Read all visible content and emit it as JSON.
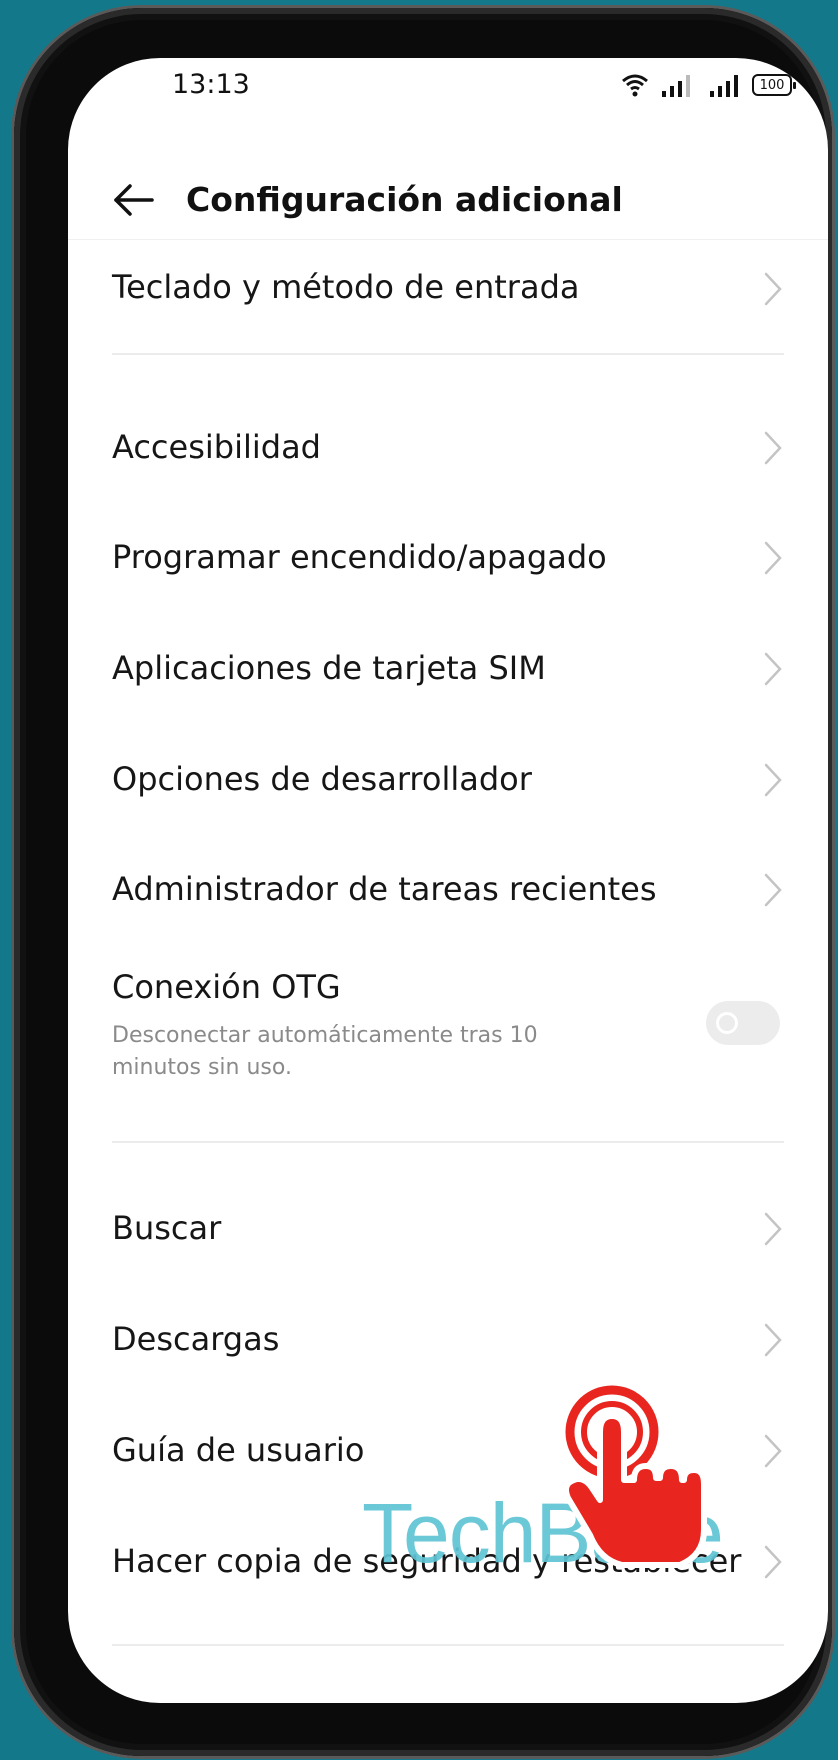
{
  "status_bar": {
    "time": "13:13",
    "battery": "100",
    "icons": [
      "wifi-icon",
      "signal-icon",
      "signal-icon",
      "battery-icon"
    ]
  },
  "app_bar": {
    "title": "Configuración adicional",
    "back_icon": "arrow-left-icon"
  },
  "settings": {
    "keyboard": "Teclado y método de entrada",
    "accessibility": "Accesibilidad",
    "schedule_power": "Programar encendido/apagado",
    "sim_apps": "Aplicaciones de tarjeta SIM",
    "developer": "Opciones de desarrollador",
    "recent_tasks": "Administrador de tareas recientes",
    "otg": {
      "label": "Conexión OTG",
      "description": "Desconectar automáticamente tras 10 minutos sin uso.",
      "enabled": false
    },
    "search": "Buscar",
    "downloads": "Descargas",
    "user_guide": "Guía de usuario",
    "backup_reset": "Hacer copia de seguridad y restablecer"
  },
  "watermark": "TechBase",
  "colors": {
    "background": "#13798a",
    "watermark": "#5ec4d4",
    "tap_indicator": "#e8261f"
  }
}
